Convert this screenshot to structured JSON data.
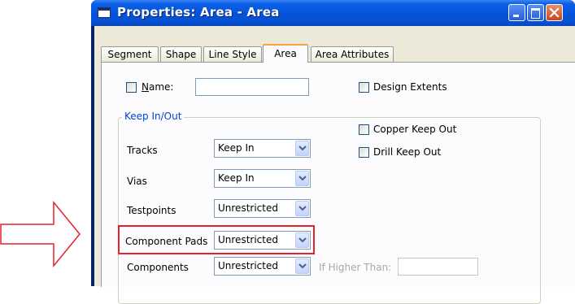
{
  "window": {
    "title": "Properties: Area - Area"
  },
  "tabs": [
    {
      "label": "Segment"
    },
    {
      "label": "Shape"
    },
    {
      "label": "Line Style"
    },
    {
      "label": "Area"
    },
    {
      "label": "Area Attributes"
    }
  ],
  "name": {
    "label_prefix": "",
    "label_underlined": "N",
    "label_rest": "ame:",
    "value": ""
  },
  "design_extents": {
    "label": "Design Extents",
    "checked": false
  },
  "keep_in_out": {
    "group_label": "Keep In/Out",
    "copper_keep_out": {
      "label": "Copper  Keep Out",
      "checked": false
    },
    "drill_keep_out": {
      "label": "Drill  Keep Out",
      "checked": false
    },
    "rows": [
      {
        "label": "Tracks",
        "value": "Keep In"
      },
      {
        "label": "Vias",
        "value": "Keep In"
      },
      {
        "label": "Testpoints",
        "value": "Unrestricted"
      },
      {
        "label": "Component Pads",
        "value": "Unrestricted"
      },
      {
        "label": "Components",
        "value": "Unrestricted"
      }
    ],
    "if_higher_than": {
      "label": "If Higher Than:",
      "value": ""
    }
  },
  "colors": {
    "highlight": "#e8202a",
    "accent": "#0046d5"
  }
}
